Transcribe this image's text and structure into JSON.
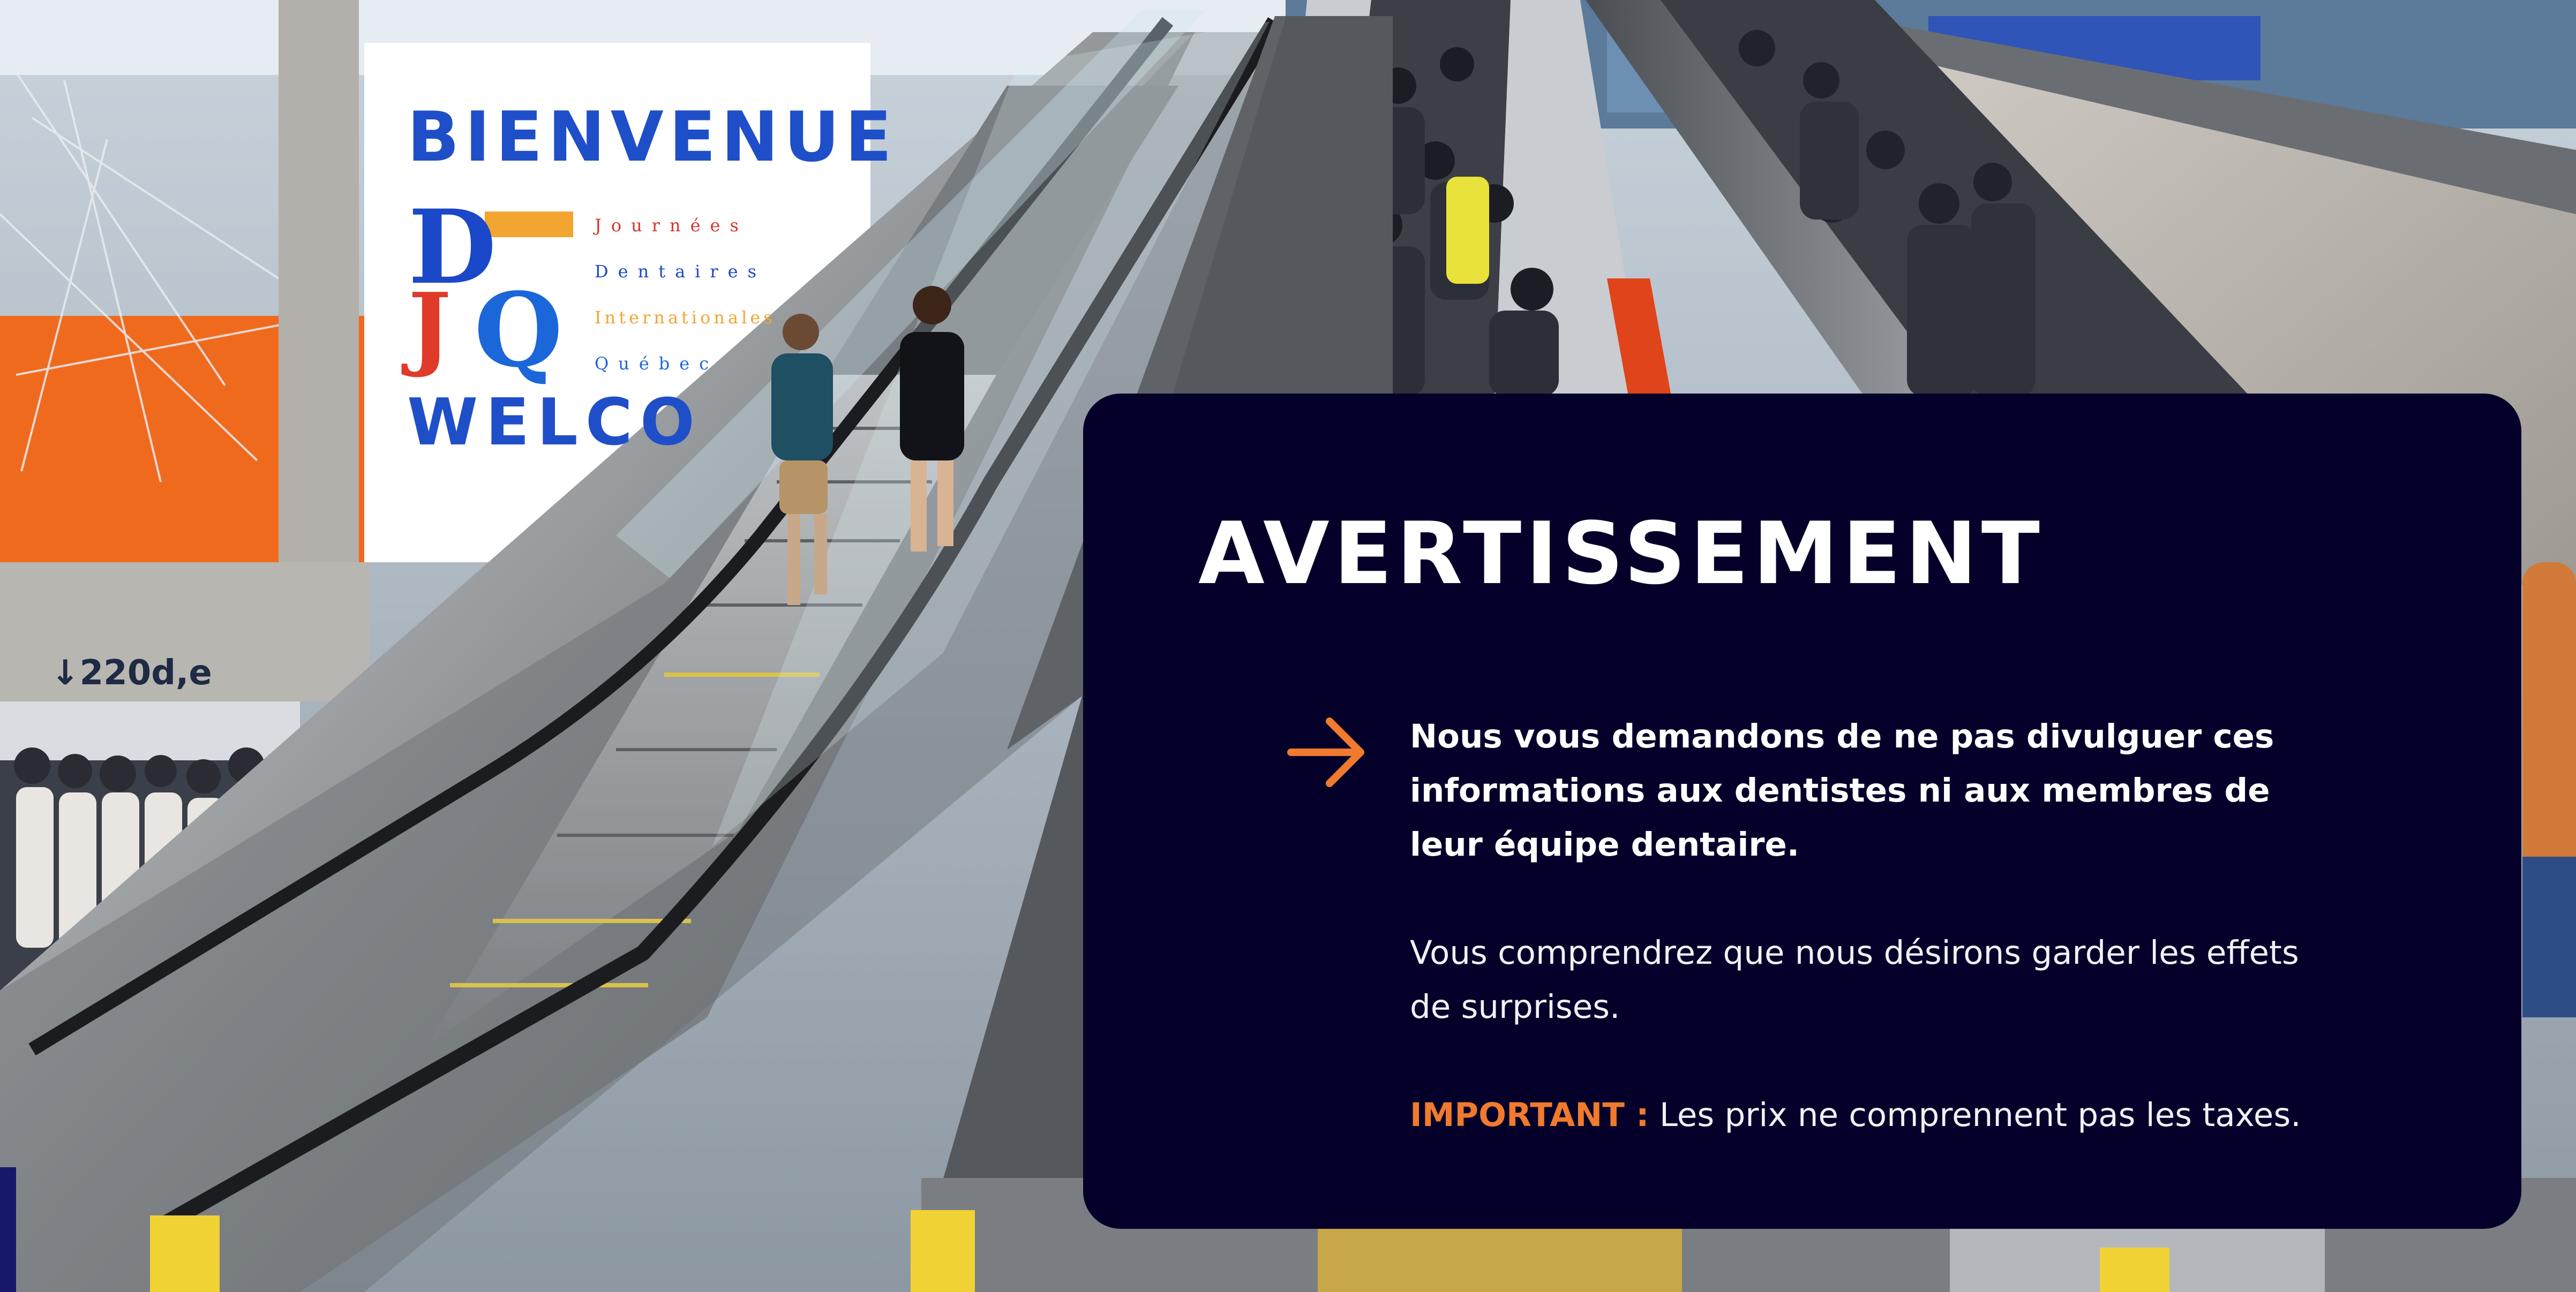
{
  "banner": {
    "welcome_top": "BIENVENUE",
    "welcome_bottom": "WELCO",
    "logo_letters": {
      "d": "D",
      "j": "J",
      "q": "Q"
    },
    "logo_words": [
      "Journées",
      "Dentaires",
      "Internationales",
      "Québec"
    ]
  },
  "signage": {
    "direction": "↓220d,e"
  },
  "notice": {
    "title": "AVERTISSEMENT",
    "paragraph_1": "Nous vous demandons de ne pas divulguer ces informations aux dentistes ni aux membres de leur équipe dentaire.",
    "paragraph_2": "Vous comprendrez que nous désirons garder les effets de surprises.",
    "important_label": "IMPORTANT :",
    "important_text": " Les prix ne comprennent pas les taxes."
  },
  "colors": {
    "card_background": "#05002a",
    "accent": "#f07a2e",
    "text": "#ffffff",
    "banner_blue": "#1f4fc8"
  },
  "icons": {
    "bullet": "arrow-right-icon"
  }
}
